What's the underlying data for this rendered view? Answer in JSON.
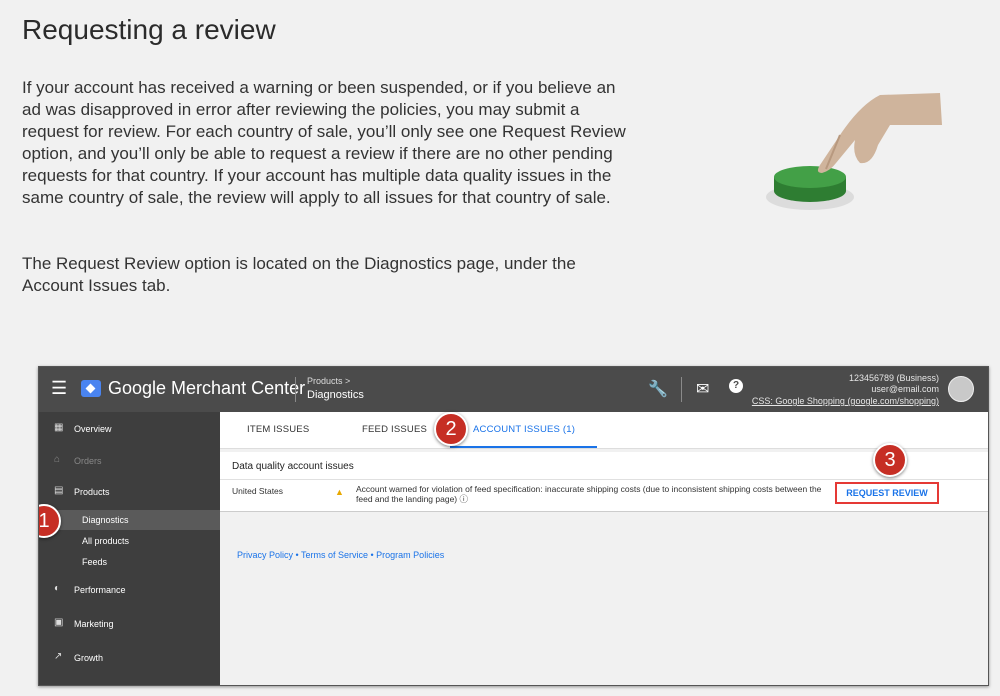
{
  "page": {
    "title": "Requesting a review",
    "paragraph1": "If your account has received a warning or been suspended, or if you believe an ad was disapproved in error after reviewing the policies, you may submit a request for review. For each country of sale, you’ll only see one Request Review option, and you’ll only be able to request a review if there are no other pending requests for that country. If your account has multiple data quality issues in the same country of sale, the review will apply to all issues for that country of sale.",
    "paragraph2": "The Request Review option is located on the Diagnostics page, under the Account Issues tab."
  },
  "app": {
    "brand": "Google Merchant Center",
    "breadcrumb_parent": "Products >",
    "breadcrumb_current": "Diagnostics",
    "account_id": "123456789 (Business)",
    "account_email": "user@email.com",
    "account_css": "CSS: Google Shopping (google.com/shopping)"
  },
  "sidebar": {
    "overview": "Overview",
    "orders": "Orders",
    "products": "Products",
    "diagnostics": "Diagnostics",
    "all_products": "All products",
    "feeds": "Feeds",
    "performance": "Performance",
    "marketing": "Marketing",
    "growth": "Growth"
  },
  "tabs": {
    "item_issues": "ITEM ISSUES",
    "feed_issues": "FEED ISSUES",
    "account_issues": "ACCOUNT ISSUES (1)"
  },
  "issues": {
    "section_title": "Data quality account issues",
    "country": "United States",
    "description": "Account warned for violation of feed specification: inaccurate shipping costs (due to inconsistent shipping costs between the feed and the landing page) ⓘ",
    "request_review": "REQUEST REVIEW"
  },
  "footer": {
    "links": "Privacy Policy • Terms of Service • Program Policies"
  },
  "markers": {
    "one": "1",
    "two": "2",
    "three": "3"
  },
  "icons": [
    "menu-icon",
    "wrench-icon",
    "mail-icon",
    "help-icon",
    "warning-icon"
  ],
  "colors": {
    "accent": "#1a73e8",
    "marker": "#c62e24",
    "button_green": "#3a9a3f"
  }
}
